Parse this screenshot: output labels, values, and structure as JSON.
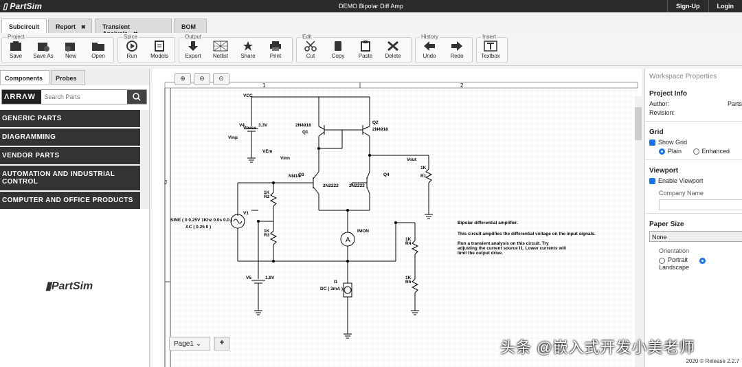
{
  "app": {
    "name": "PartSim",
    "doc_title": "DEMO Bipolar Diff Amp",
    "signup": "Sign-Up",
    "login": "Login"
  },
  "tabs": [
    {
      "label": "Subcircuit"
    },
    {
      "label": "Report"
    },
    {
      "label": "Transient Analysis"
    },
    {
      "label": "BOM"
    }
  ],
  "toolbar": {
    "groups": [
      "Project",
      "Spice",
      "Output",
      "Edit",
      "History",
      "Insert"
    ],
    "buttons": [
      "Save",
      "Save As",
      "New",
      "Open",
      "Run",
      "Models",
      "Export",
      "Netlist",
      "Share",
      "Print",
      "Cut",
      "Copy",
      "Paste",
      "Delete",
      "Undo",
      "Redo",
      "Textbox"
    ]
  },
  "left": {
    "tabs": [
      "Components",
      "Probes"
    ],
    "arrow_logo": "ΛRRΛW",
    "search_placeholder": "Search Parts",
    "categories": [
      "GENERIC PARTS",
      "DIAGRAMMING",
      "VENDOR PARTS",
      "AUTOMATION AND INDUSTRIAL CONTROL",
      "COMPUTER AND OFFICE PRODUCTS"
    ],
    "brand": "PartSim"
  },
  "canvas": {
    "col1": "1",
    "col2": "2",
    "row": "J",
    "page": "Page1",
    "add": "+",
    "labels": {
      "vcc": "VCC",
      "v4": "V4",
      "vbase": "Vbase",
      "v33": "3.3V",
      "vinp": "Vinp",
      "vem": "VEm",
      "vinn": "Vinn",
      "q1": "Q1",
      "q1p": "2N4918",
      "q2": "Q2",
      "q2p": "2N4918",
      "q3p": "2N2222",
      "q4p": "2N2222",
      "q3": "Q3",
      "q4": "Q4",
      "nn": "NN14",
      "vout": "Vout",
      "r1": "R1",
      "k1": "1K",
      "r2": "R2",
      "r3": "R3",
      "r4": "R4",
      "r5": "R5",
      "v1": "V1",
      "sine": "SINE ( 0 0.25V 1Khz 0.0s 0.0 )",
      "ac": "AC ( 0.25 0 )",
      "imon": "IMON",
      "v5": "V5",
      "v18": "1.8V",
      "i1": "I1",
      "dc": "DC ( 3mA )",
      "q": "Q"
    },
    "note1": "Bipolar differential amplifier.",
    "note2": "This circuit amplifies the differential voltage on the input signals.",
    "note3": "Run a transient analysis on this circuit. Try",
    "note4": "adjusting the current source I1. Lower currents will",
    "note5": "limit the output drive."
  },
  "right": {
    "title": "Workspace Properties",
    "project_info": "Project Info",
    "author": "Author:",
    "author_val": "Parts",
    "revision": "Revision:",
    "grid": "Grid",
    "show_grid": "Show Grid",
    "plain": "Plain",
    "enhanced": "Enhanced",
    "viewport": "Viewport",
    "enable_viewport": "Enable Viewport",
    "company": "Company Name",
    "paper": "Paper Size",
    "paper_val": "None",
    "orientation": "Orientation",
    "portrait": "Portrait",
    "landscape": "Landscape",
    "release": "2020 © Release 2.2.7"
  },
  "watermark": "头条 @嵌入式开发小美老师"
}
